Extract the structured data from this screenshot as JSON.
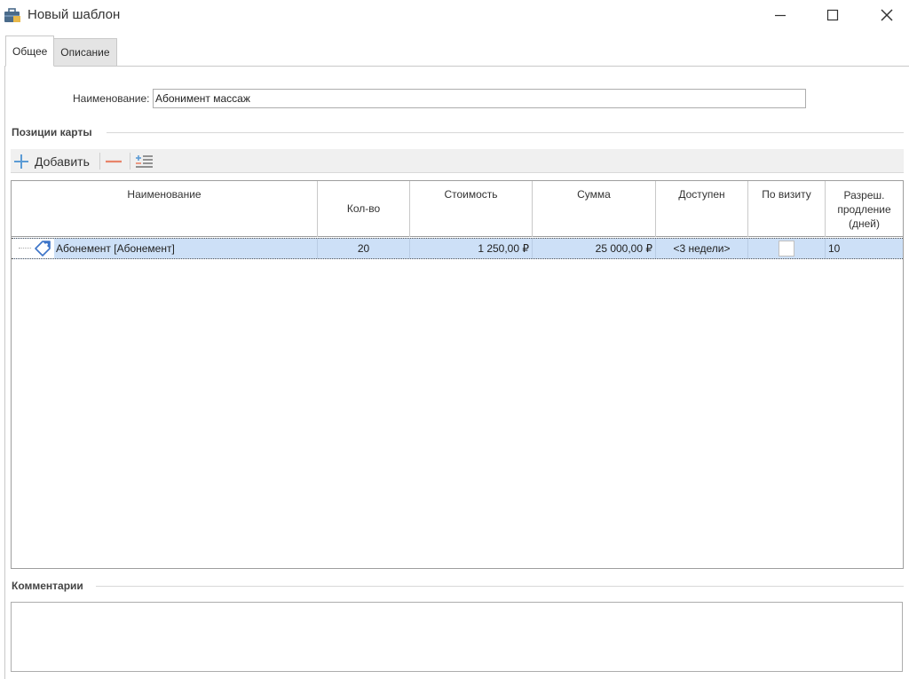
{
  "window": {
    "title": "Новый шаблон",
    "icon": "briefcase-icon"
  },
  "tabs": [
    {
      "label": "Общее",
      "active": true
    },
    {
      "label": "Описание",
      "active": false
    }
  ],
  "form": {
    "name_label": "Наименование:",
    "name_value": "Абонимент массаж"
  },
  "positions": {
    "title": "Позиции карты",
    "toolbar": {
      "add_label": "Добавить",
      "add_icon": "plus-icon",
      "remove_icon": "minus-icon",
      "extra_icon": "add-subitem-icon"
    },
    "columns": {
      "name": "Наименование",
      "qty": "Кол-во",
      "cost": "Стоимость",
      "sum": "Сумма",
      "available": "Доступен",
      "per_visit": "По визиту",
      "extend_1": "Разреш.",
      "extend_2": "продление",
      "extend_3": "(дней)"
    },
    "rows": [
      {
        "name": "Абонемент [Абонемент]",
        "qty": "20",
        "cost": "1 250,00 ₽",
        "sum": "25 000,00 ₽",
        "available": "<3 недели>",
        "per_visit": false,
        "extend_days": "10"
      }
    ]
  },
  "comments": {
    "title": "Комментарии",
    "value": ""
  },
  "colors": {
    "selected_row": "#cde0f7",
    "add_icon": "#5b9bd5",
    "remove_icon": "#e8846a",
    "tag_icon": "#3c74c8"
  }
}
